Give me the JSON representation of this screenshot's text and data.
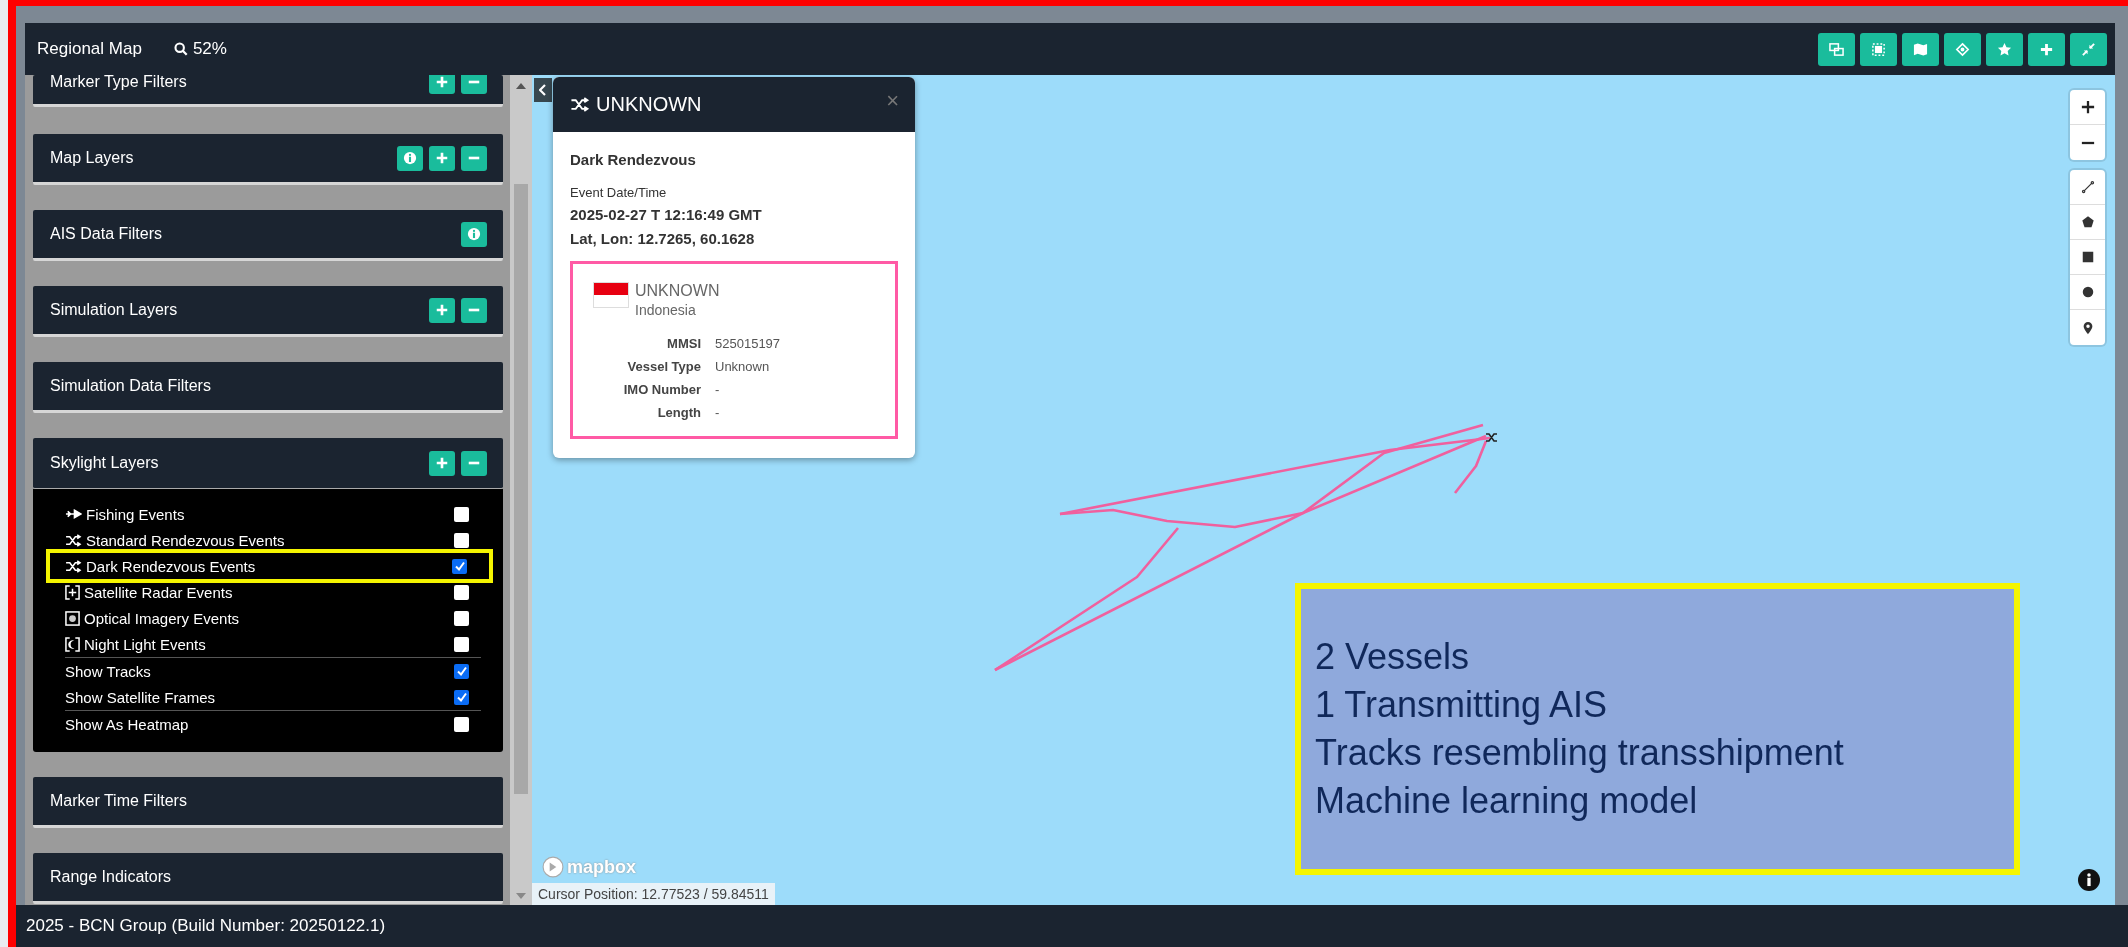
{
  "header": {
    "title": "Regional Map",
    "zoom": "52%"
  },
  "sidebar": {
    "panels": [
      {
        "title": "Marker Type Filters",
        "info_button": false,
        "add_remove_buttons": true,
        "expanded": false
      },
      {
        "title": "Map Layers",
        "info_button": true,
        "add_remove_buttons": true,
        "expanded": false
      },
      {
        "title": "AIS Data Filters",
        "info_button": true,
        "add_remove_buttons": false,
        "expanded": false
      },
      {
        "title": "Simulation Layers",
        "info_button": false,
        "add_remove_buttons": true,
        "expanded": false
      },
      {
        "title": "Simulation Data Filters",
        "info_button": false,
        "add_remove_buttons": false,
        "expanded": false
      },
      {
        "title": "Skylight Layers",
        "info_button": false,
        "add_remove_buttons": true,
        "expanded": true,
        "groups": [
          [
            {
              "label": "Fishing Events",
              "kind": "fishing",
              "checked": false,
              "highlighted": false
            },
            {
              "label": "Standard Rendezvous Events",
              "kind": "rendezvous",
              "checked": false,
              "highlighted": false
            },
            {
              "label": "Dark Rendezvous Events",
              "kind": "rendezvous",
              "checked": true,
              "highlighted": true
            },
            {
              "label": "Satellite Radar Events",
              "kind": "radar",
              "checked": false,
              "highlighted": false
            },
            {
              "label": "Optical Imagery Events",
              "kind": "optical",
              "checked": false,
              "highlighted": false
            },
            {
              "label": "Night Light Events",
              "kind": "night",
              "checked": false,
              "highlighted": false
            }
          ],
          [
            {
              "label": "Show Tracks",
              "kind": "option",
              "checked": true,
              "highlighted": false
            },
            {
              "label": "Show Satellite Frames",
              "kind": "option",
              "checked": true,
              "highlighted": false
            }
          ],
          [
            {
              "label": "Show As Heatmap",
              "kind": "option",
              "checked": false,
              "highlighted": false
            }
          ]
        ]
      },
      {
        "title": "Marker Time Filters",
        "info_button": false,
        "add_remove_buttons": false,
        "expanded": false
      },
      {
        "title": "Range Indicators",
        "info_button": false,
        "add_remove_buttons": false,
        "expanded": false
      }
    ]
  },
  "map": {
    "popup": {
      "title": "UNKNOWN",
      "close": "×",
      "event_type": "Dark Rendezvous",
      "date_label": "Event Date/Time",
      "date": "2025-02-27 T 12:16:49 GMT",
      "position": "Lat, Lon: 12.7265, 60.1628",
      "vessel": {
        "name": "UNKNOWN",
        "country": "Indonesia",
        "fields": [
          {
            "label": "MMSI",
            "value": "525015197"
          },
          {
            "label": "Vessel Type",
            "value": "Unknown"
          },
          {
            "label": "IMO Number",
            "value": "-"
          },
          {
            "label": "Length",
            "value": "-"
          }
        ]
      }
    },
    "attribution": "mapbox",
    "cursor_position": "Cursor Position: 12.77523 / 59.84511",
    "annotation": [
      "2 Vessels",
      "1 Transmitting AIS",
      "Tracks resembling transshipment",
      "Machine learning model"
    ]
  },
  "footer": "2025 - BCN Group (Build Number: 20250122.1)"
}
